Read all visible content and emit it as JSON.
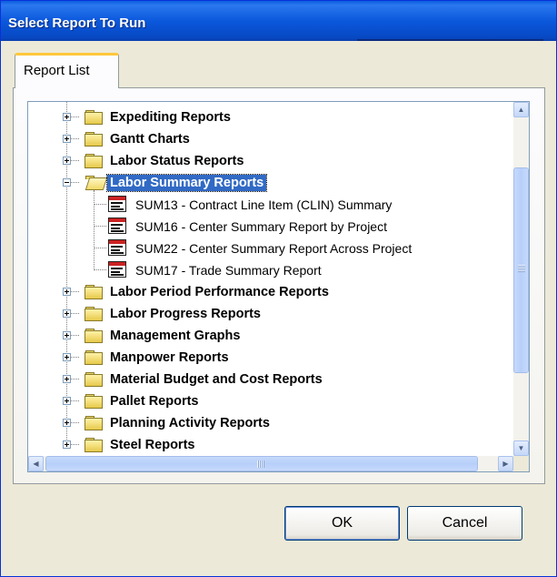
{
  "window": {
    "title": "Select Report To Run"
  },
  "tabs": [
    {
      "label": "Report List"
    }
  ],
  "tree": {
    "rows": [
      {
        "type": "folder",
        "label": "Expediting Reports",
        "expanded": false
      },
      {
        "type": "folder",
        "label": "Gantt Charts",
        "expanded": false
      },
      {
        "type": "folder",
        "label": "Labor  Status Reports",
        "expanded": false
      },
      {
        "type": "folder",
        "label": "Labor  Summary Reports",
        "expanded": true,
        "selected": true
      },
      {
        "type": "report",
        "label": "SUM13 - Contract Line Item (CLIN) Summary"
      },
      {
        "type": "report",
        "label": "SUM16 - Center Summary Report by Project"
      },
      {
        "type": "report",
        "label": "SUM22 - Center Summary Report Across Project"
      },
      {
        "type": "report",
        "label": "SUM17 - Trade Summary Report"
      },
      {
        "type": "folder",
        "label": "Labor Period Performance Reports",
        "expanded": false
      },
      {
        "type": "folder",
        "label": "Labor Progress Reports",
        "expanded": false
      },
      {
        "type": "folder",
        "label": "Management Graphs",
        "expanded": false
      },
      {
        "type": "folder",
        "label": "Manpower Reports",
        "expanded": false
      },
      {
        "type": "folder",
        "label": "Material Budget and Cost Reports",
        "expanded": false
      },
      {
        "type": "folder",
        "label": "Pallet Reports",
        "expanded": false
      },
      {
        "type": "folder",
        "label": "Planning Activity Reports",
        "expanded": false
      },
      {
        "type": "folder",
        "label": "Steel Reports",
        "expanded": false
      }
    ]
  },
  "scrollbars": {
    "up": "▲",
    "down": "▼",
    "left": "◀",
    "right": "▶",
    "grip": "III",
    "vertical_position": 0.45,
    "horizontal_position": 0.5
  },
  "buttons": {
    "ok": "OK",
    "cancel": "Cancel"
  },
  "colors": {
    "titlebar": "#0a5ddf",
    "selection": "#316ac5",
    "tab_accent": "#ffc83c"
  }
}
